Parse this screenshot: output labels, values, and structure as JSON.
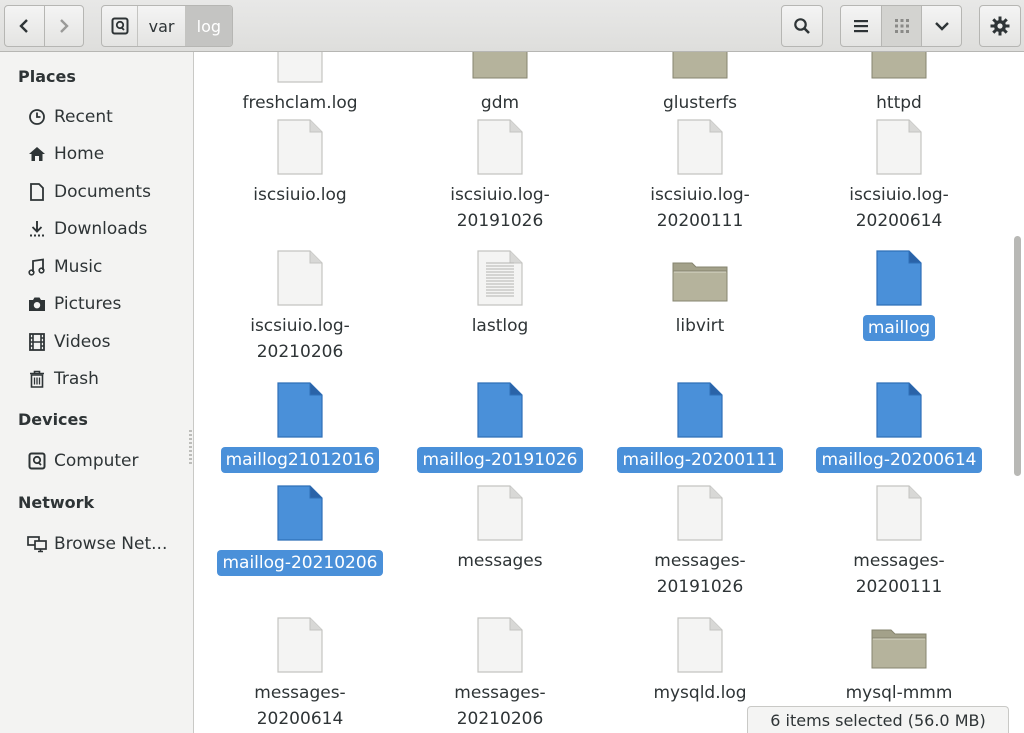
{
  "path": [
    "var",
    "log"
  ],
  "sidebar": {
    "places_heading": "Places",
    "places": [
      {
        "label": "Recent",
        "icon": "clock-icon"
      },
      {
        "label": "Home",
        "icon": "home-icon"
      },
      {
        "label": "Documents",
        "icon": "document-icon"
      },
      {
        "label": "Downloads",
        "icon": "download-icon"
      },
      {
        "label": "Music",
        "icon": "music-icon"
      },
      {
        "label": "Pictures",
        "icon": "camera-icon"
      },
      {
        "label": "Videos",
        "icon": "film-icon"
      },
      {
        "label": "Trash",
        "icon": "trash-icon"
      }
    ],
    "devices_heading": "Devices",
    "devices": [
      {
        "label": "Computer",
        "icon": "drive-icon"
      }
    ],
    "network_heading": "Network",
    "network": [
      {
        "label": "Browse Net...",
        "icon": "network-icon"
      }
    ]
  },
  "files": [
    {
      "name": [
        "freshclam.log"
      ],
      "type": "file",
      "selected": false
    },
    {
      "name": [
        "gdm"
      ],
      "type": "folder",
      "selected": false
    },
    {
      "name": [
        "glusterfs"
      ],
      "type": "folder",
      "selected": false
    },
    {
      "name": [
        "httpd"
      ],
      "type": "folder",
      "selected": false
    },
    {
      "name": [
        "iscsiuio.log"
      ],
      "type": "file",
      "selected": false
    },
    {
      "name": [
        "iscsiuio.log-",
        "20191026"
      ],
      "type": "file",
      "selected": false
    },
    {
      "name": [
        "iscsiuio.log-",
        "20200111"
      ],
      "type": "file",
      "selected": false
    },
    {
      "name": [
        "iscsiuio.log-",
        "20200614"
      ],
      "type": "file",
      "selected": false
    },
    {
      "name": [
        "iscsiuio.log-",
        "20210206"
      ],
      "type": "file",
      "selected": false
    },
    {
      "name": [
        "lastlog"
      ],
      "type": "text-file",
      "selected": false
    },
    {
      "name": [
        "libvirt"
      ],
      "type": "folder",
      "selected": false
    },
    {
      "name": [
        "maillog"
      ],
      "type": "file",
      "selected": true
    },
    {
      "name": [
        "maillog21012016"
      ],
      "type": "file",
      "selected": true
    },
    {
      "name": [
        "maillog-20191026"
      ],
      "type": "file",
      "selected": true
    },
    {
      "name": [
        "maillog-20200111"
      ],
      "type": "file",
      "selected": true
    },
    {
      "name": [
        "maillog-20200614"
      ],
      "type": "file",
      "selected": true
    },
    {
      "name": [
        "maillog-20210206"
      ],
      "type": "file",
      "selected": true
    },
    {
      "name": [
        "messages"
      ],
      "type": "file",
      "selected": false
    },
    {
      "name": [
        "messages-",
        "20191026"
      ],
      "type": "file",
      "selected": false
    },
    {
      "name": [
        "messages-",
        "20200111"
      ],
      "type": "file",
      "selected": false
    },
    {
      "name": [
        "messages-",
        "20200614"
      ],
      "type": "file",
      "selected": false
    },
    {
      "name": [
        "messages-",
        "20210206"
      ],
      "type": "file",
      "selected": false
    },
    {
      "name": [
        "mysqld.log"
      ],
      "type": "file",
      "selected": false
    },
    {
      "name": [
        "mysql-mmm"
      ],
      "type": "folder",
      "selected": false
    }
  ],
  "status": "6 items selected  (56.0 MB)",
  "colors": {
    "selection": "#4a90d9",
    "folder": "#b5b39c"
  }
}
